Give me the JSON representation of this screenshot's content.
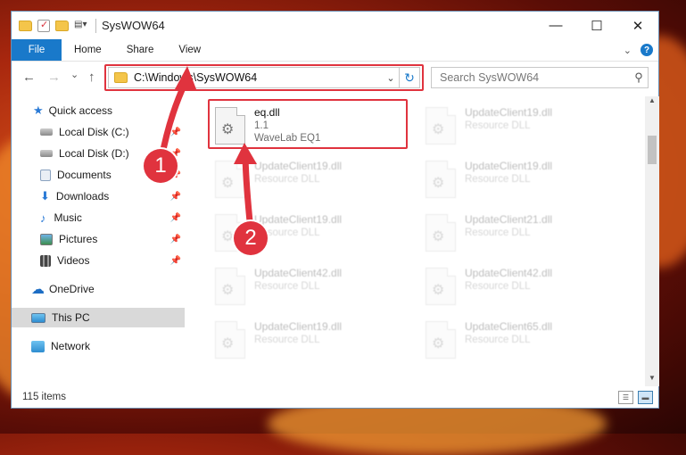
{
  "window": {
    "title": "SysWOW64",
    "controls": {
      "minimize": "—",
      "maximize": "☐",
      "close": "✕"
    }
  },
  "ribbon": {
    "tabs": [
      "File",
      "Home",
      "Share",
      "View"
    ],
    "expand_icon": "chevron-down-icon",
    "help_icon": "?"
  },
  "nav": {
    "back": "←",
    "forward": "→",
    "recent": "⌄",
    "up": "↑",
    "address": "C:\\Windows\\SysWOW64",
    "search_placeholder": "Search SysWOW64"
  },
  "sidebar": {
    "items": [
      {
        "label": "Quick access",
        "icon": "star-icon",
        "pinned": false
      },
      {
        "label": "Local Disk (C:)",
        "icon": "drive-icon",
        "pinned": true
      },
      {
        "label": "Local Disk (D:)",
        "icon": "drive-icon",
        "pinned": true
      },
      {
        "label": "Documents",
        "icon": "document-icon",
        "pinned": true
      },
      {
        "label": "Downloads",
        "icon": "download-icon",
        "pinned": true
      },
      {
        "label": "Music",
        "icon": "music-icon",
        "pinned": true
      },
      {
        "label": "Pictures",
        "icon": "picture-icon",
        "pinned": true
      },
      {
        "label": "Videos",
        "icon": "video-icon",
        "pinned": true
      },
      {
        "label": "OneDrive",
        "icon": "cloud-icon",
        "pinned": false
      },
      {
        "label": "This PC",
        "icon": "computer-icon",
        "pinned": false,
        "selected": true
      },
      {
        "label": "Network",
        "icon": "network-icon",
        "pinned": false
      }
    ]
  },
  "files": [
    {
      "name": "eq.dll",
      "line2": "1.1",
      "line3": "WaveLab EQ1",
      "highlighted": true
    },
    {
      "name": "UpdateClient19.dll",
      "line2": "Resource DLL"
    },
    {
      "name": "UpdateClient19.dll",
      "line2": "Resource DLL"
    },
    {
      "name": "UpdateClient19.dll",
      "line2": "Resource DLL"
    },
    {
      "name": "UpdateClient19.dll",
      "line2": "Resource DLL"
    },
    {
      "name": "UpdateClient21.dll",
      "line2": "Resource DLL"
    },
    {
      "name": "UpdateClient42.dll",
      "line2": "Resource DLL"
    },
    {
      "name": "UpdateClient42.dll",
      "line2": "Resource DLL"
    },
    {
      "name": "UpdateClient19.dll",
      "line2": "Resource DLL"
    },
    {
      "name": "UpdateClient65.dll",
      "line2": "Resource DLL"
    }
  ],
  "status": {
    "item_count": "115 items"
  },
  "annotations": {
    "step1": "1",
    "step2": "2"
  },
  "colors": {
    "accent": "#1979ca",
    "annotation": "#e0333e",
    "folder": "#f4c54a"
  }
}
